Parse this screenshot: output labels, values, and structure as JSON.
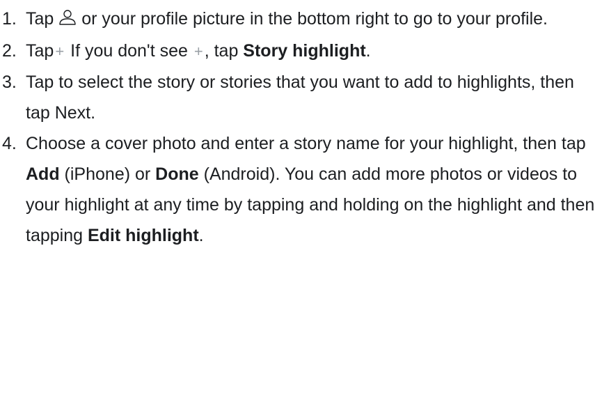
{
  "steps": [
    {
      "number": "1.",
      "parts": {
        "a": "Tap ",
        "b": " or your profile picture in the bottom right to go to your profile."
      }
    },
    {
      "number": "2.",
      "parts": {
        "a": "Tap",
        "plus1": "+",
        "b": " If you don't see ",
        "plus2": "+",
        "c": ", tap ",
        "bold1": "Story highlight",
        "d": "."
      }
    },
    {
      "number": "3.",
      "parts": {
        "a": "Tap to select the story or stories that you want to add to highlights, then tap Next."
      }
    },
    {
      "number": "4.",
      "parts": {
        "a": "Choose a cover photo and enter a story name for your highlight, then tap ",
        "bold1": "Add",
        "b": " (iPhone) or ",
        "bold2": "Done",
        "c": " (Android). You can add more photos or videos to your highlight at any time by tapping and holding on the highlight and then tapping ",
        "bold3": "Edit highlight",
        "d": "."
      }
    }
  ],
  "icons": {
    "profile": "profile-icon",
    "plus": "plus-icon"
  }
}
